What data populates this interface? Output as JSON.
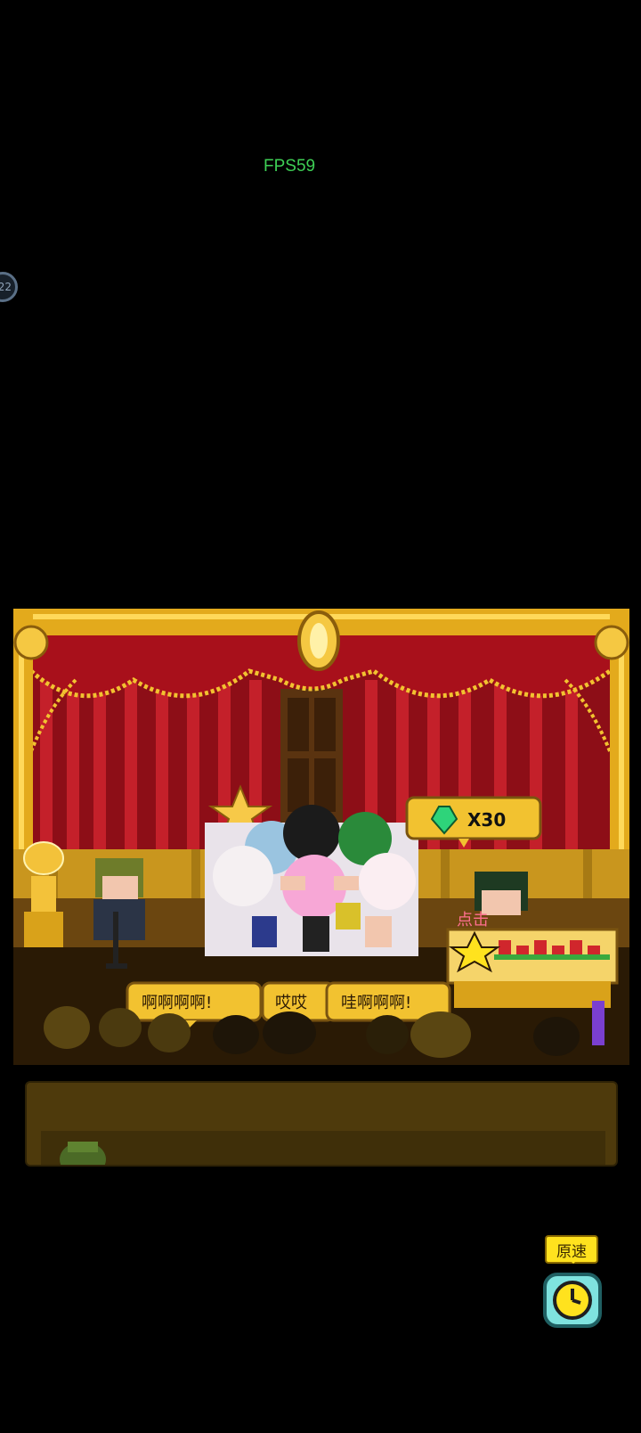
{
  "fps": "FPS59",
  "side_button_text": "22",
  "gem_reward": {
    "text": "X30",
    "icon": "green-gem-icon"
  },
  "click_hint": "点击",
  "speech_bubbles": [
    "啊啊啊啊!",
    "哎哎",
    "哇啊啊啊!"
  ],
  "speed_button": {
    "label": "原速",
    "icon": "clock-icon"
  },
  "colors": {
    "curtain": "#b5121b",
    "gold": "#f2c230",
    "panel": "#4e3a0c"
  }
}
